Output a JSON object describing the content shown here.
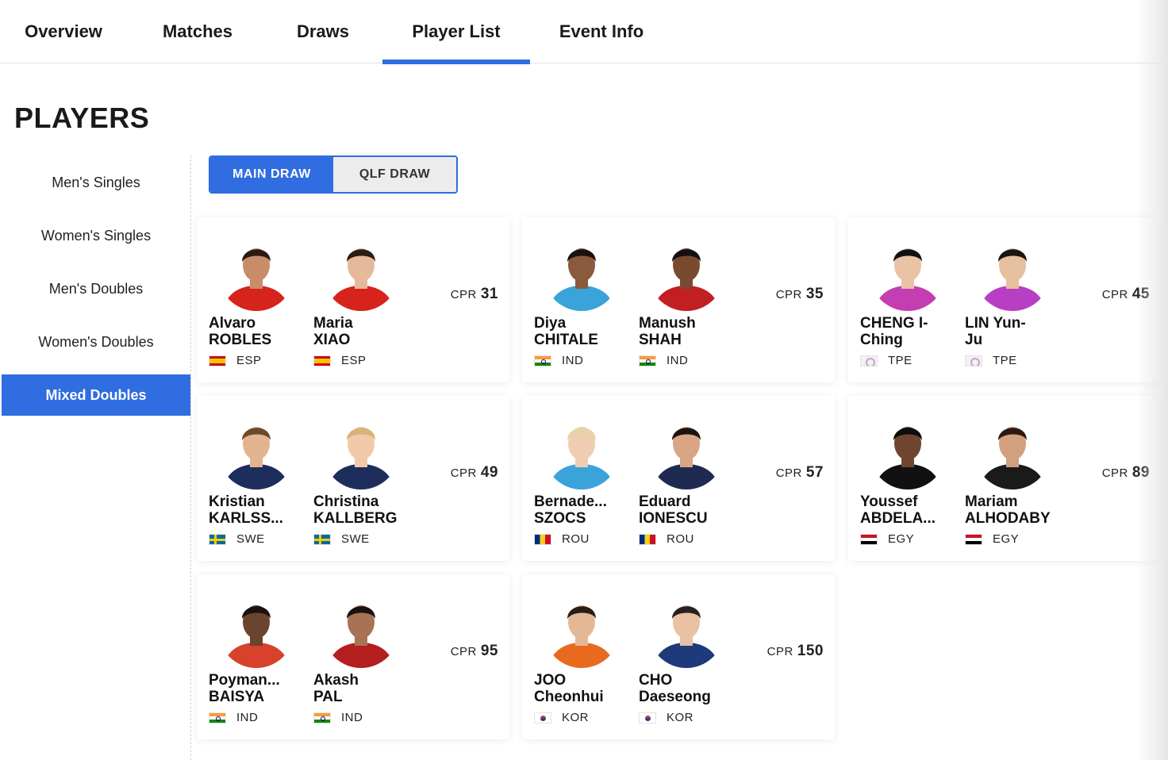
{
  "nav": {
    "tabs": [
      {
        "label": "Overview"
      },
      {
        "label": "Matches"
      },
      {
        "label": "Draws"
      },
      {
        "label": "Player List"
      },
      {
        "label": "Event Info"
      }
    ],
    "active_tab": "Player List"
  },
  "page": {
    "title": "PLAYERS"
  },
  "sidebar": {
    "items": [
      {
        "label": "Men's Singles"
      },
      {
        "label": "Women's Singles"
      },
      {
        "label": "Men's Doubles"
      },
      {
        "label": "Women's Doubles"
      },
      {
        "label": "Mixed Doubles"
      }
    ],
    "active": "Mixed Doubles"
  },
  "draw_toggle": {
    "main": "MAIN DRAW",
    "qlf": "QLF DRAW",
    "active": "MAIN DRAW"
  },
  "cpr_label": "CPR",
  "accent_color": "#2f6de0",
  "pairs": [
    {
      "cpr": "31",
      "players": [
        {
          "first": "Alvaro",
          "last": "ROBLES",
          "country": "ESP"
        },
        {
          "first": "Maria",
          "last": "XIAO",
          "country": "ESP"
        }
      ]
    },
    {
      "cpr": "35",
      "players": [
        {
          "first": "Diya",
          "last": "CHITALE",
          "country": "IND"
        },
        {
          "first": "Manush",
          "last": "SHAH",
          "country": "IND"
        }
      ]
    },
    {
      "cpr": "45",
      "players": [
        {
          "first": "CHENG I-",
          "last": "Ching",
          "country": "TPE"
        },
        {
          "first": "LIN Yun-",
          "last": "Ju",
          "country": "TPE"
        }
      ]
    },
    {
      "cpr": "49",
      "players": [
        {
          "first": "Kristian",
          "last": "KARLSS...",
          "country": "SWE"
        },
        {
          "first": "Christina",
          "last": "KALLBERG",
          "country": "SWE"
        }
      ]
    },
    {
      "cpr": "57",
      "players": [
        {
          "first": "Bernade...",
          "last": "SZOCS",
          "country": "ROU"
        },
        {
          "first": "Eduard",
          "last": "IONESCU",
          "country": "ROU"
        }
      ]
    },
    {
      "cpr": "89",
      "players": [
        {
          "first": "Youssef",
          "last": "ABDELA...",
          "country": "EGY"
        },
        {
          "first": "Mariam",
          "last": "ALHODABY",
          "country": "EGY"
        }
      ]
    },
    {
      "cpr": "95",
      "players": [
        {
          "first": "Poyman...",
          "last": "BAISYA",
          "country": "IND"
        },
        {
          "first": "Akash",
          "last": "PAL",
          "country": "IND"
        }
      ]
    },
    {
      "cpr": "150",
      "players": [
        {
          "first": "JOO",
          "last": "Cheonhui",
          "country": "KOR"
        },
        {
          "first": "CHO",
          "last": "Daeseong",
          "country": "KOR"
        }
      ]
    }
  ],
  "jersey_colors": [
    "#d6231c",
    "#d6231c",
    "#3aa3d9",
    "#c21f22",
    "#c43db3",
    "#b83ec4",
    "#1d2d5c",
    "#1d2d5c",
    "#3aa3d9",
    "#1e2a4f",
    "#111111",
    "#1a1a1a",
    "#d8412a",
    "#b51e1e",
    "#e86a1f",
    "#1e3a7a"
  ]
}
